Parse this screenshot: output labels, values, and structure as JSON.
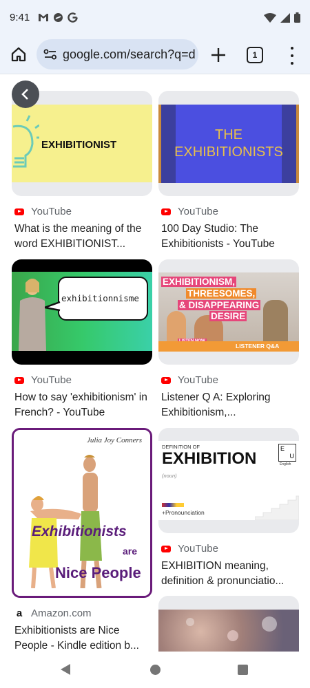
{
  "status": {
    "time": "9:41"
  },
  "browser": {
    "url": "google.com/search?q=d",
    "tab_count": "1"
  },
  "results": [
    {
      "thumb_text": "EXHIBITIONIST",
      "source": "YouTube",
      "title": "What is the meaning of the word EXHIBITIONIST..."
    },
    {
      "thumb_text_1": "THE",
      "thumb_text_2": "EXHIBITIONISTS",
      "source": "YouTube",
      "title": "100 Day Studio: The Exhibitionists - YouTube"
    },
    {
      "thumb_text": "exhibitionnisme",
      "source": "YouTube",
      "title": "How to say 'exhibitionism' in French? - YouTube"
    },
    {
      "thumb_text_1": "EXHIBITIONISM,",
      "thumb_text_2": "THREESOMES,",
      "thumb_text_3": "& DISAPPEARING",
      "thumb_text_4": "DESIRE",
      "badge_1": "LISTEN NOW",
      "badge_2": "LISTENER Q&A",
      "source": "YouTube",
      "title": "Listener Q A: Exploring Exhibitionism,..."
    },
    {
      "thumb_author": "Julia Joy Conners",
      "thumb_text_1": "Exhibitionists",
      "thumb_text_2": "are",
      "thumb_text_3": "Nice People",
      "source": "Amazon.com",
      "title": "Exhibitionists are Nice People - Kindle edition b..."
    },
    {
      "thumb_text_1": "DEFINITION OF",
      "thumb_text_2": "EXHIBITION",
      "thumb_text_3": "(noun)",
      "thumb_text_4": "+Pronounciation",
      "thumb_logo_1": "E",
      "thumb_logo_2": "U",
      "thumb_logo_3": "English",
      "source": "YouTube",
      "title": "EXHIBITION meaning, definition & pronunciatio..."
    }
  ]
}
